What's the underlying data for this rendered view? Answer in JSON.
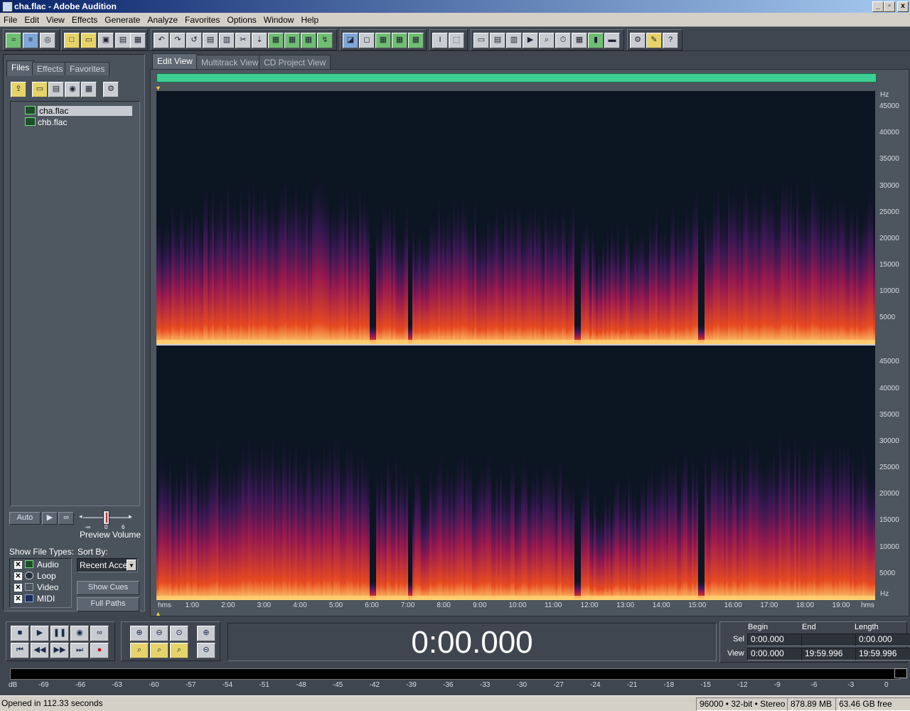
{
  "window": {
    "title": "cha.flac - Adobe Audition",
    "buttons": [
      "_",
      "▫",
      "x"
    ]
  },
  "menu": [
    "File",
    "Edit",
    "View",
    "Effects",
    "Generate",
    "Analyze",
    "Favorites",
    "Options",
    "Window",
    "Help"
  ],
  "left_panel": {
    "tabs": [
      "Files",
      "Effects",
      "Favorites"
    ],
    "files": [
      {
        "name": "cha.flac",
        "selected": true
      },
      {
        "name": "chb.flac",
        "selected": false
      }
    ],
    "auto_label": "Auto",
    "preview_volume_label": "Preview Volume",
    "slider_min": "-∞",
    "slider_max": "6",
    "slider_mid": "0",
    "show_file_types_label": "Show File Types:",
    "file_types": [
      {
        "label": "Audio",
        "checked": true
      },
      {
        "label": "Loop",
        "checked": true
      },
      {
        "label": "Video",
        "checked": true
      },
      {
        "label": "MIDI",
        "checked": true
      }
    ],
    "sort_by_label": "Sort By:",
    "sort_by_value": "Recent Acce",
    "show_cues_label": "Show Cues",
    "full_paths_label": "Full Paths"
  },
  "view_tabs": [
    "Edit View",
    "Multitrack View",
    "CD Project View"
  ],
  "spectrogram": {
    "freq_unit": "Hz",
    "freq_ticks": [
      "45000",
      "40000",
      "35000",
      "30000",
      "25000",
      "20000",
      "15000",
      "10000",
      "5000"
    ],
    "time_unit": "hms",
    "time_ticks": [
      "1:00",
      "2:00",
      "3:00",
      "4:00",
      "5:00",
      "6:00",
      "7:00",
      "8:00",
      "9:00",
      "10:00",
      "11:00",
      "12:00",
      "13:00",
      "14:00",
      "15:00",
      "16:00",
      "17:00",
      "18:00",
      "19:00"
    ],
    "colors": {
      "background": "#0c1522",
      "low": "#5a1a7a",
      "mid": "#c21a5e",
      "high": "#ff5020",
      "peak": "#ffd070"
    }
  },
  "transport": {
    "current_time": "0:00.000"
  },
  "selection": {
    "headers": [
      "Begin",
      "End",
      "Length"
    ],
    "sel_label": "Sel",
    "view_label": "View",
    "sel": {
      "begin": "0:00.000",
      "end": "",
      "length": "0:00.000"
    },
    "view": {
      "begin": "0:00.000",
      "end": "19:59.996",
      "length": "19:59.996"
    }
  },
  "meter": {
    "db_label": "dB",
    "ticks": [
      "-69",
      "-66",
      "-63",
      "-60",
      "-57",
      "-54",
      "-51",
      "-48",
      "-45",
      "-42",
      "-39",
      "-36",
      "-33",
      "-30",
      "-27",
      "-24",
      "-21",
      "-18",
      "-15",
      "-12",
      "-9",
      "-6",
      "-3",
      "0"
    ]
  },
  "status": {
    "message": "Opened in 112.33 seconds",
    "format": "96000 • 32-bit • Stereo",
    "size": "878.89 MB",
    "free": "63.46 GB free"
  }
}
